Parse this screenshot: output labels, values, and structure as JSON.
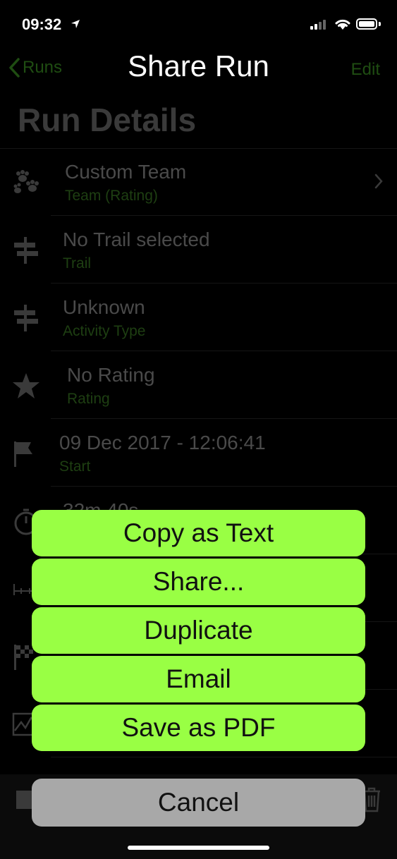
{
  "status_bar": {
    "time": "09:32"
  },
  "nav": {
    "back_label": "Runs",
    "title": "Share Run",
    "edit_label": "Edit"
  },
  "page": {
    "large_title": "Run Details"
  },
  "rows": [
    {
      "title": "Custom Team",
      "subtitle": "Team (Rating)",
      "icon": "paw-prints-icon"
    },
    {
      "title": "No Trail selected",
      "subtitle": "Trail",
      "icon": "signpost-icon"
    },
    {
      "title": "Unknown",
      "subtitle": "Activity Type",
      "icon": "signpost-icon"
    },
    {
      "title": "No Rating",
      "subtitle": "Rating",
      "icon": "star-icon"
    },
    {
      "title": "09 Dec 2017 - 12:06:41",
      "subtitle": "Start",
      "icon": "flag-icon"
    },
    {
      "title": "32m 40s",
      "subtitle": "",
      "icon": "stopwatch-icon"
    }
  ],
  "action_sheet": {
    "actions": [
      "Copy as Text",
      "Share...",
      "Duplicate",
      "Email",
      "Save as PDF"
    ],
    "cancel_label": "Cancel"
  },
  "colors": {
    "action_button": "#99ff44",
    "cancel_button": "#a8a8a8",
    "tint_dimmed": "#1f4d12",
    "background": "#000000"
  }
}
